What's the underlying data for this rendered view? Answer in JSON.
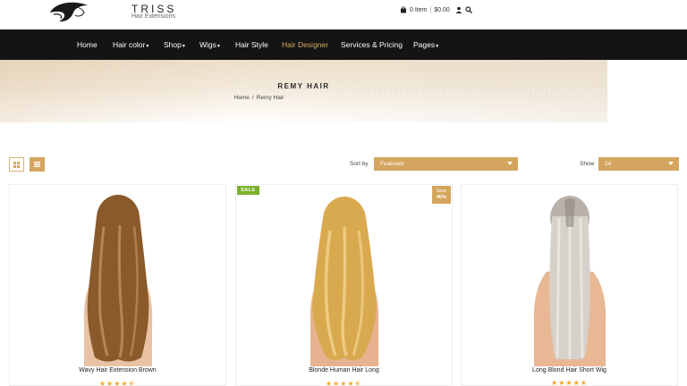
{
  "brand": {
    "title": "TRISS",
    "subtitle": "Hair Extensions"
  },
  "cart": {
    "count_label": "0 Item",
    "total": "$0.00"
  },
  "nav": {
    "items": [
      {
        "label": "Home",
        "dropdown": false,
        "active": false
      },
      {
        "label": "Hair color",
        "dropdown": true,
        "active": false
      },
      {
        "label": "Shop",
        "dropdown": true,
        "active": false
      },
      {
        "label": "Wigs",
        "dropdown": true,
        "active": false
      },
      {
        "label": "Hair Style",
        "dropdown": false,
        "active": false
      },
      {
        "label": "Hair Designer",
        "dropdown": false,
        "active": true
      },
      {
        "label": "Services & Pricing",
        "dropdown": false,
        "active": false
      },
      {
        "label": "Pages",
        "dropdown": true,
        "active": false
      }
    ]
  },
  "banner": {
    "title": "REMY HAIR",
    "breadcrumb": [
      "Home",
      "/",
      "Remy Hair"
    ]
  },
  "toolbar": {
    "sort_label": "Sort by",
    "sort_value": "Featured",
    "show_label": "Show",
    "show_value": "24"
  },
  "products": [
    {
      "name": "Wavy Hair Extension Brown",
      "rating": 4.5,
      "stars": "★★★★⯪",
      "badge_sale": "",
      "badge_save_top": "",
      "badge_save_pct": "",
      "hair_color": "#8a5a2b",
      "hair_highlight": "#c89a62",
      "style": "wavy"
    },
    {
      "name": "Blonde Human Hair Long",
      "rating": 4.5,
      "stars": "★★★★⯪",
      "badge_sale": "SALE",
      "badge_save_top": "Save",
      "badge_save_pct": "40%",
      "hair_color": "#d9a94f",
      "hair_highlight": "#f1d38e",
      "style": "wavy"
    },
    {
      "name": "Long Blond Hair Short Wig",
      "rating": 5,
      "stars": "★★★★★",
      "badge_sale": "",
      "badge_save_top": "",
      "badge_save_pct": "",
      "hair_color": "#b8b2aa",
      "hair_highlight": "#ece8e2",
      "style": "straight"
    }
  ],
  "colors": {
    "accent": "#d4a55e",
    "nav_bg": "#141414",
    "nav_active": "#d8a95d",
    "sale": "#7bb12a",
    "stars": "#f5a623"
  }
}
